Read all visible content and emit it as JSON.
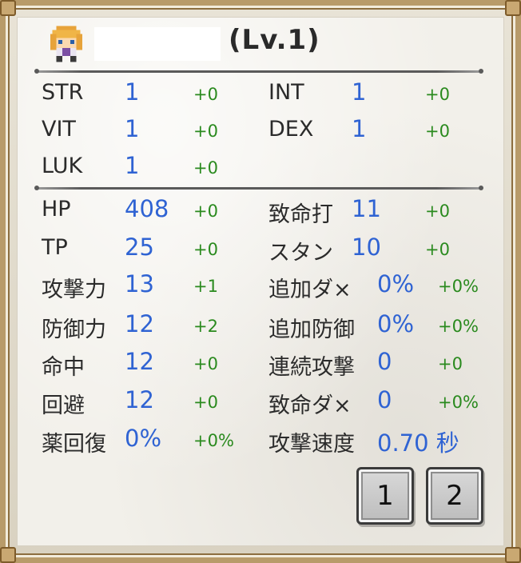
{
  "header": {
    "level_text": "(Lv.1)"
  },
  "basic_stats": [
    {
      "label": "STR",
      "value": "1",
      "bonus": "+0"
    },
    {
      "label": "INT",
      "value": "1",
      "bonus": "+0"
    },
    {
      "label": "VIT",
      "value": "1",
      "bonus": "+0"
    },
    {
      "label": "DEX",
      "value": "1",
      "bonus": "+0"
    },
    {
      "label": "LUK",
      "value": "1",
      "bonus": "+0"
    }
  ],
  "combat_stats": [
    {
      "label": "HP",
      "value": "408",
      "bonus": "+0"
    },
    {
      "label": "致命打",
      "value": "11",
      "bonus": "+0"
    },
    {
      "label": "TP",
      "value": "25",
      "bonus": "+0"
    },
    {
      "label": "スタン",
      "value": "10",
      "bonus": "+0"
    },
    {
      "label": "攻撃力",
      "value": "13",
      "bonus": "+1"
    },
    {
      "label": "追加ダ×",
      "value": "0%",
      "bonus": "+0%"
    },
    {
      "label": "防御力",
      "value": "12",
      "bonus": "+2"
    },
    {
      "label": "追加防御",
      "value": "0%",
      "bonus": "+0%"
    },
    {
      "label": "命中",
      "value": "12",
      "bonus": "+0"
    },
    {
      "label": "連続攻撃",
      "value": "0",
      "bonus": "+0"
    },
    {
      "label": "回避",
      "value": "12",
      "bonus": "+0"
    },
    {
      "label": "致命ダ×",
      "value": "0",
      "bonus": "+0%"
    },
    {
      "label": "薬回復",
      "value": "0%",
      "bonus": "+0%"
    },
    {
      "label": "攻撃速度",
      "value": "0.70 秒",
      "bonus": ""
    }
  ],
  "pager": {
    "page1_label": "1",
    "page2_label": "2"
  },
  "colors": {
    "value": "#2f63d3",
    "bonus": "#2a8a1e",
    "label": "#2b2b2b"
  }
}
